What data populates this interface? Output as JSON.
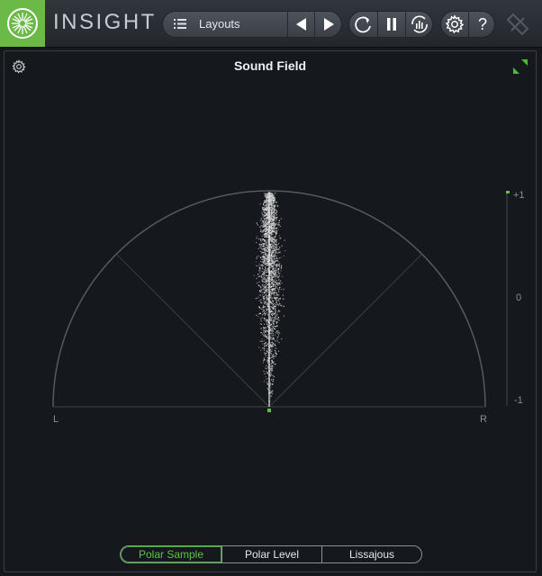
{
  "app": {
    "name": "INSIGHT"
  },
  "toolbar": {
    "layouts_label": "Layouts",
    "prev_icon": "triangle-left-icon",
    "next_icon": "triangle-right-icon",
    "loop_icon": "loop-icon",
    "pause_icon": "pause-icon",
    "reset_icon": "reset-meters-icon",
    "settings_icon": "gear-icon",
    "help_label": "?"
  },
  "panel": {
    "title": "Sound Field",
    "modes": [
      "Polar Sample",
      "Polar Level",
      "Lissajous"
    ],
    "active_mode": "Polar Sample"
  },
  "scope": {
    "left_label": "L",
    "right_label": "R",
    "correlation_ticks": [
      "+1",
      "0",
      "-1"
    ]
  },
  "colors": {
    "accent": "#5fc246",
    "logo_bg": "#6bb946",
    "background": "#15181d"
  }
}
